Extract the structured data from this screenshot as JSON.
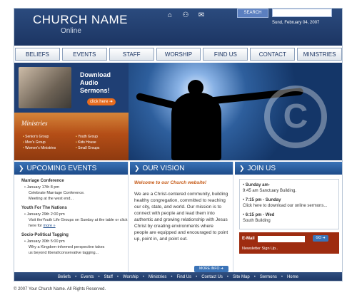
{
  "header": {
    "church_name": "CHURCH NAME",
    "subtitle": "Online",
    "icons": [
      "home-icon",
      "sitemap-icon",
      "mail-icon"
    ],
    "search_label": "SEARCH",
    "date": "Sund, February 04, 2007"
  },
  "nav": [
    "BELIEFS",
    "EVENTS",
    "STAFF",
    "WORSHIP",
    "FIND US",
    "CONTACT",
    "MINISTRIES"
  ],
  "promo_audio": {
    "text_line1": "Download",
    "text_line2": "Audio",
    "text_line3": "Sermons!",
    "button": "click here"
  },
  "ministries": {
    "title": "Ministries",
    "left": [
      "Senior's Group",
      "Men's Group",
      "Women's Ministries"
    ],
    "right": [
      "Youth Group",
      "Kids House",
      "Small Groups"
    ]
  },
  "upcoming": {
    "heading": "UPCOMING EVENTS",
    "events": [
      {
        "title": "Marriage Conference",
        "date": "January 17th 8 pm",
        "line1": "Celebrate Marriage Conference.",
        "line2": "Meeting at the west end..."
      },
      {
        "title": "Youth For The Nations",
        "date": "January 29th 2:00 pm",
        "line1": "Visit theYouth Life Groups on Sunday at the table or click here for",
        "more": "more »"
      },
      {
        "title": "Socio-Political Tagging",
        "date": "January 30th 5:00 pm",
        "line1": "Why a Kingdom-informed perspective takes",
        "line2": "us beyond liberal/conservative tagging..."
      }
    ]
  },
  "vision": {
    "heading": "OUR VISION",
    "welcome": "Welcome to our Church website!",
    "text": "We are a Christ-centered community, building healthy congregation, committed to reaching our city, state, and world. Our mission is to connect with people and lead them into authentic and growing relationship with Jesus Christ by creating environments where people are equipped and encouraged to point up, point in, and point out.",
    "more_info": "MORE INFO"
  },
  "join": {
    "heading": "JOIN US",
    "items": [
      {
        "time": "Sunday am-",
        "desc": "9:45 am Sanctuary Building."
      },
      {
        "time": "7:15 pm - Sunday",
        "desc": "Click here to download our online sermons..."
      },
      {
        "time": "6:15 pm - Wed",
        "desc": "South Building"
      }
    ],
    "email_label": "E-Mail",
    "go": "GO",
    "newsletter": "Newsletter Sign Up.."
  },
  "footer": [
    "Beliefs",
    "Events",
    "Staff",
    "Worship",
    "Ministries",
    "Find Us",
    "Contact Us",
    "Site Map",
    "Sermons",
    "Home"
  ],
  "copyright": "© 2007 Your Church Name.  All Rights Reserved."
}
